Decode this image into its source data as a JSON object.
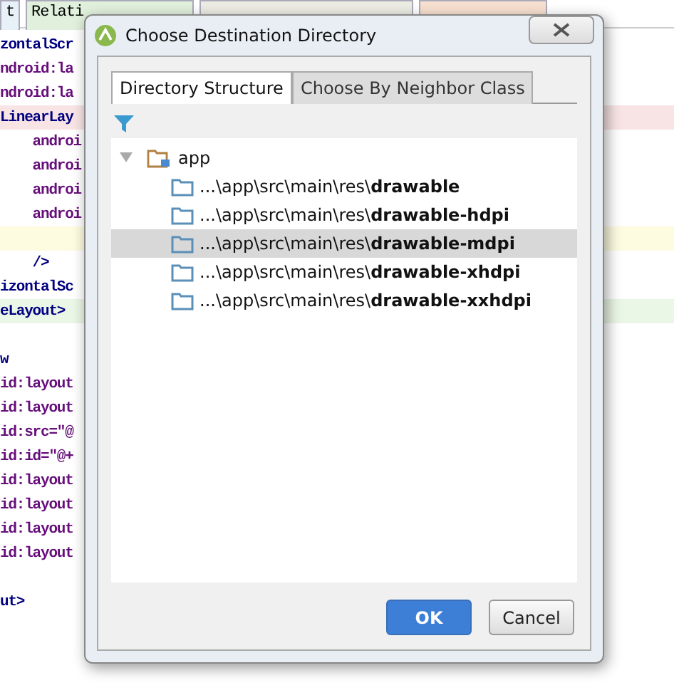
{
  "editor_tabs": [
    {
      "label": "t",
      "color": "#e8f0f8"
    },
    {
      "label": "Relati",
      "color": "#e0f0dc"
    },
    {
      "color": "#ecece4"
    },
    {
      "color": "#f8e0d0"
    }
  ],
  "editor_lines": [
    {
      "text": "zontalScr",
      "kind": "tag"
    },
    {
      "text": "ndroid:la",
      "kind": "attr"
    },
    {
      "text": "ndroid:la",
      "kind": "attr"
    },
    {
      "text": "LinearLay",
      "kind": "tag",
      "color": "#f8e4e4"
    },
    {
      "text": "    androi",
      "kind": "attr"
    },
    {
      "text": "    androi",
      "kind": "attr"
    },
    {
      "text": "    androi",
      "kind": "attr"
    },
    {
      "text": "    androi",
      "kind": "attr"
    },
    {
      "kind": "blank",
      "color": "#fdfbe0"
    },
    {
      "text": "    />",
      "kind": "tag"
    },
    {
      "text": "izontalSc",
      "kind": "tag"
    },
    {
      "text": "eLayout>",
      "kind": "tag",
      "color": "#eaf6e6"
    },
    {
      "kind": "blank"
    },
    {
      "text": "w",
      "kind": "tag"
    },
    {
      "text": "id:layout",
      "kind": "attr"
    },
    {
      "text": "id:layout",
      "kind": "attr"
    },
    {
      "text": "id:src=\"@",
      "kind": "attr"
    },
    {
      "text": "id:id=\"@+",
      "kind": "attr"
    },
    {
      "text": "id:layout",
      "kind": "attr"
    },
    {
      "text": "id:layout",
      "kind": "attr"
    },
    {
      "text": "id:layout",
      "kind": "attr"
    },
    {
      "text": "id:layout",
      "kind": "attr"
    },
    {
      "kind": "blank"
    },
    {
      "text": "ut>",
      "kind": "tag"
    }
  ],
  "dialog": {
    "title": "Choose Destination Directory",
    "tabs": [
      {
        "label": "Directory Structure",
        "selected": true
      },
      {
        "label": "Choose By Neighbor Class",
        "selected": false
      }
    ],
    "tree": [
      {
        "label": "app",
        "expanded": true,
        "selected": false,
        "children": [
          {
            "label": "...\\app\\src\\main\\res\\**drawable**",
            "selected": false
          },
          {
            "label": "...\\app\\src\\main\\res\\**drawable-hdpi**",
            "selected": false
          },
          {
            "label": "...\\app\\src\\main\\res\\**drawable-mdpi**",
            "selected": true
          },
          {
            "label": "...\\app\\src\\main\\res\\**drawable-xhdpi**",
            "selected": false
          },
          {
            "label": "...\\app\\src\\main\\res\\**drawable-xxhdpi**",
            "selected": false
          }
        ]
      }
    ],
    "buttons": [
      {
        "label": "OK",
        "kind": "primary"
      },
      {
        "label": "Cancel",
        "kind": "secondary"
      }
    ]
  }
}
